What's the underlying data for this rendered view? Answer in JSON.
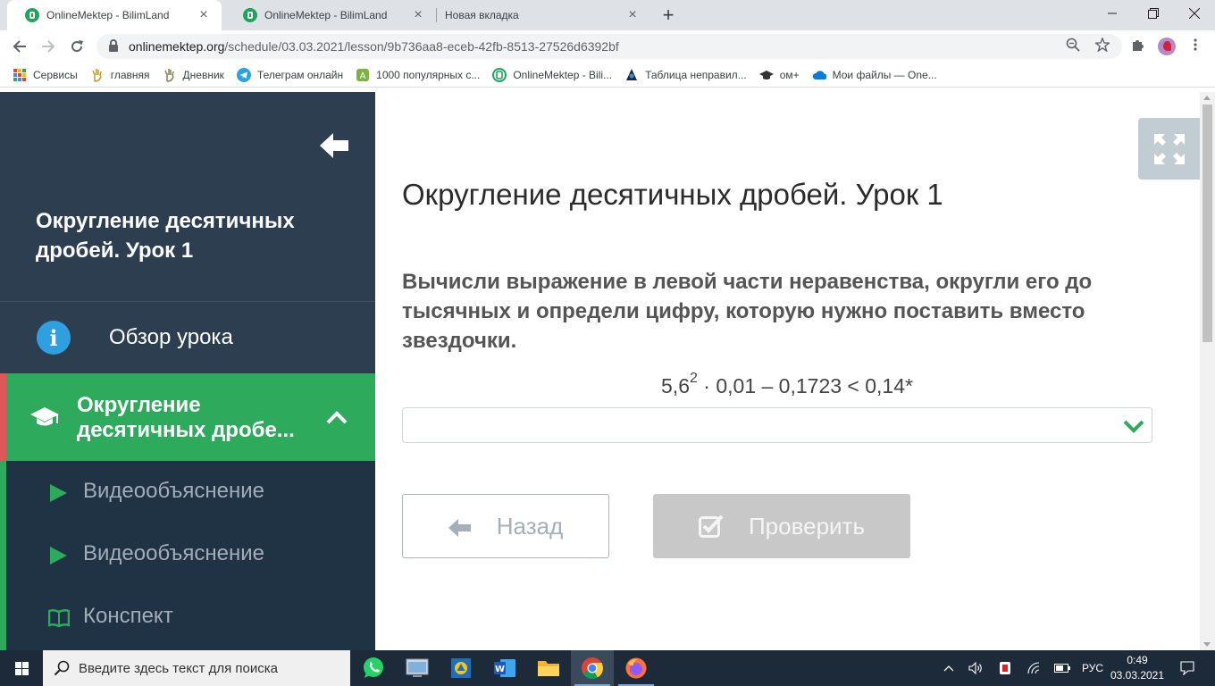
{
  "browser": {
    "tabs": [
      {
        "title": "OnlineMektep - BilimLand",
        "active": true
      },
      {
        "title": "OnlineMektep - BilimLand",
        "active": false
      },
      {
        "title": "Новая вкладка",
        "active": false
      }
    ],
    "tab_close": "×",
    "new_tab": "+",
    "url_host": "onlinemektep.org",
    "url_path": "/schedule/03.03.2021/lesson/9b736aa8-eceb-42fb-8513-27526d6392bf",
    "bookmarks": [
      {
        "label": "Сервисы",
        "icon": "apps-grid-icon"
      },
      {
        "label": "главняя",
        "icon": "hand-icon"
      },
      {
        "label": "Дневник",
        "icon": "hand-icon"
      },
      {
        "label": "Телеграм онлайн",
        "icon": "telegram-icon"
      },
      {
        "label": "1000 популярных с...",
        "icon": "android-icon"
      },
      {
        "label": "OnlineMektep - Bili...",
        "icon": "bilimland-icon"
      },
      {
        "label": "Таблица неправил...",
        "icon": "hooded-icon"
      },
      {
        "label": "ом+",
        "icon": "graduation-cap-icon"
      },
      {
        "label": "Мои файлы — One...",
        "icon": "onedrive-icon"
      }
    ]
  },
  "sidebar": {
    "lesson_title": "Округление десятичных дробей. Урок 1",
    "overview_label": "Обзор урока",
    "info_glyph": "i",
    "active_section_label": "Округление десятичных дробе...",
    "sub_items": [
      {
        "label": "Видеообъяснение",
        "icon": "play-icon"
      },
      {
        "label": "Видеообъяснение",
        "icon": "play-icon"
      },
      {
        "label": "Конспект",
        "icon": "book-icon"
      }
    ]
  },
  "main": {
    "title": "Округление десятичных дробей. Урок 1",
    "question": "Вычисли выражение в левой части неравенства, округли его до тысячных и определи цифру, которую нужно поставить вместо звездочки.",
    "expression_base": "5,6",
    "expression_exponent": "2",
    "expression_rest": " · 0,01 – 0,1723 < 0,14*",
    "answer_value": "",
    "back_label": "Назад",
    "check_label": "Проверить"
  },
  "taskbar": {
    "search_placeholder": "Введите здесь текст для поиска",
    "language": "РУС",
    "time": "0:49",
    "date": "03.03.2021"
  },
  "colors": {
    "sidebar_bg": "#2c3e50",
    "sidebar_active": "#2daa5c",
    "sidebar_sub_bg": "#1f3345",
    "accent_red": "#e0565b",
    "info_blue": "#2f9fe0"
  }
}
